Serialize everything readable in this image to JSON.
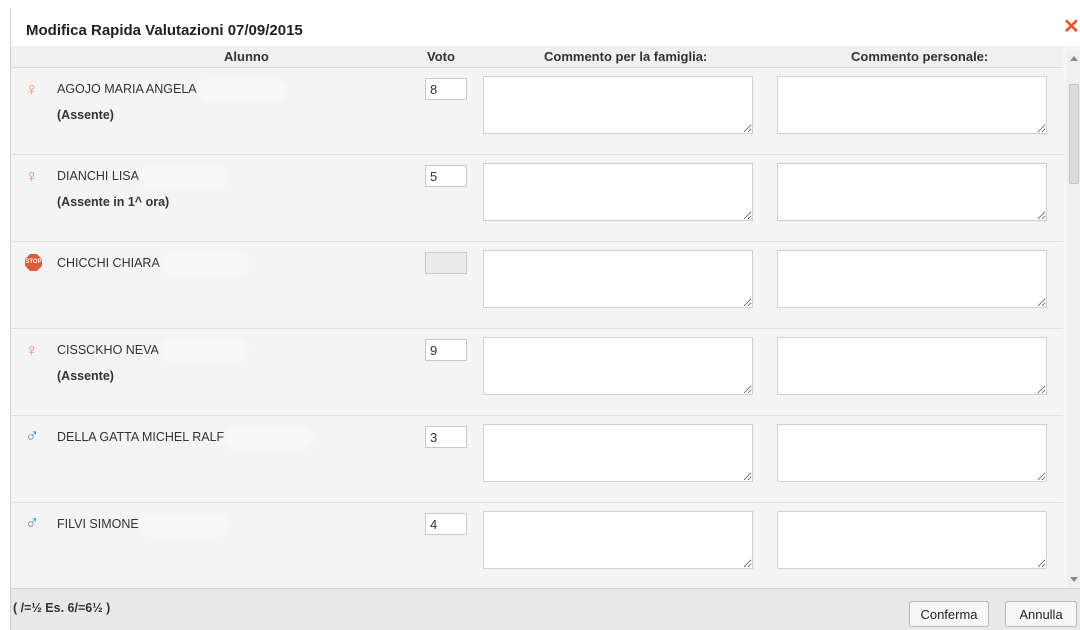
{
  "dialog": {
    "title": "Modifica Rapida Valutazioni 07/09/2015",
    "close_icon": "close-icon"
  },
  "columns": {
    "student": "Alunno",
    "grade": "Voto",
    "family_comment": "Commento per la famiglia:",
    "personal_comment": "Commento personale:"
  },
  "students": [
    {
      "name": "AGOJO MARIA ANGELA",
      "status": "(Assente)",
      "icon": "female-icon",
      "grade": "8",
      "disabled": false
    },
    {
      "name": "DIANCHI LISA",
      "status": "(Assente in 1^ ora)",
      "icon": "female-icon",
      "grade": "5",
      "disabled": false
    },
    {
      "name": "CHICCHI CHIARA",
      "status": "",
      "icon": "stop-icon",
      "grade": "",
      "disabled": true
    },
    {
      "name": "CISSCKHO NEVA",
      "status": "(Assente)",
      "icon": "female-icon",
      "grade": "9",
      "disabled": false
    },
    {
      "name": "DELLA GATTA MICHEL RALF",
      "status": "",
      "icon": "male-icon",
      "grade": "3",
      "disabled": false
    },
    {
      "name": "FILVI SIMONE",
      "status": "",
      "icon": "male-icon",
      "grade": "4",
      "disabled": false
    }
  ],
  "footer": {
    "hint": "( /=½ Es. 6/=6½ )",
    "confirm_label": "Conferma",
    "cancel_label": "Annulla"
  },
  "stop_icon_text": "STOP",
  "colors": {
    "female": "#f08a6c",
    "male": "#3a8ccc",
    "close": "#e8552f"
  }
}
